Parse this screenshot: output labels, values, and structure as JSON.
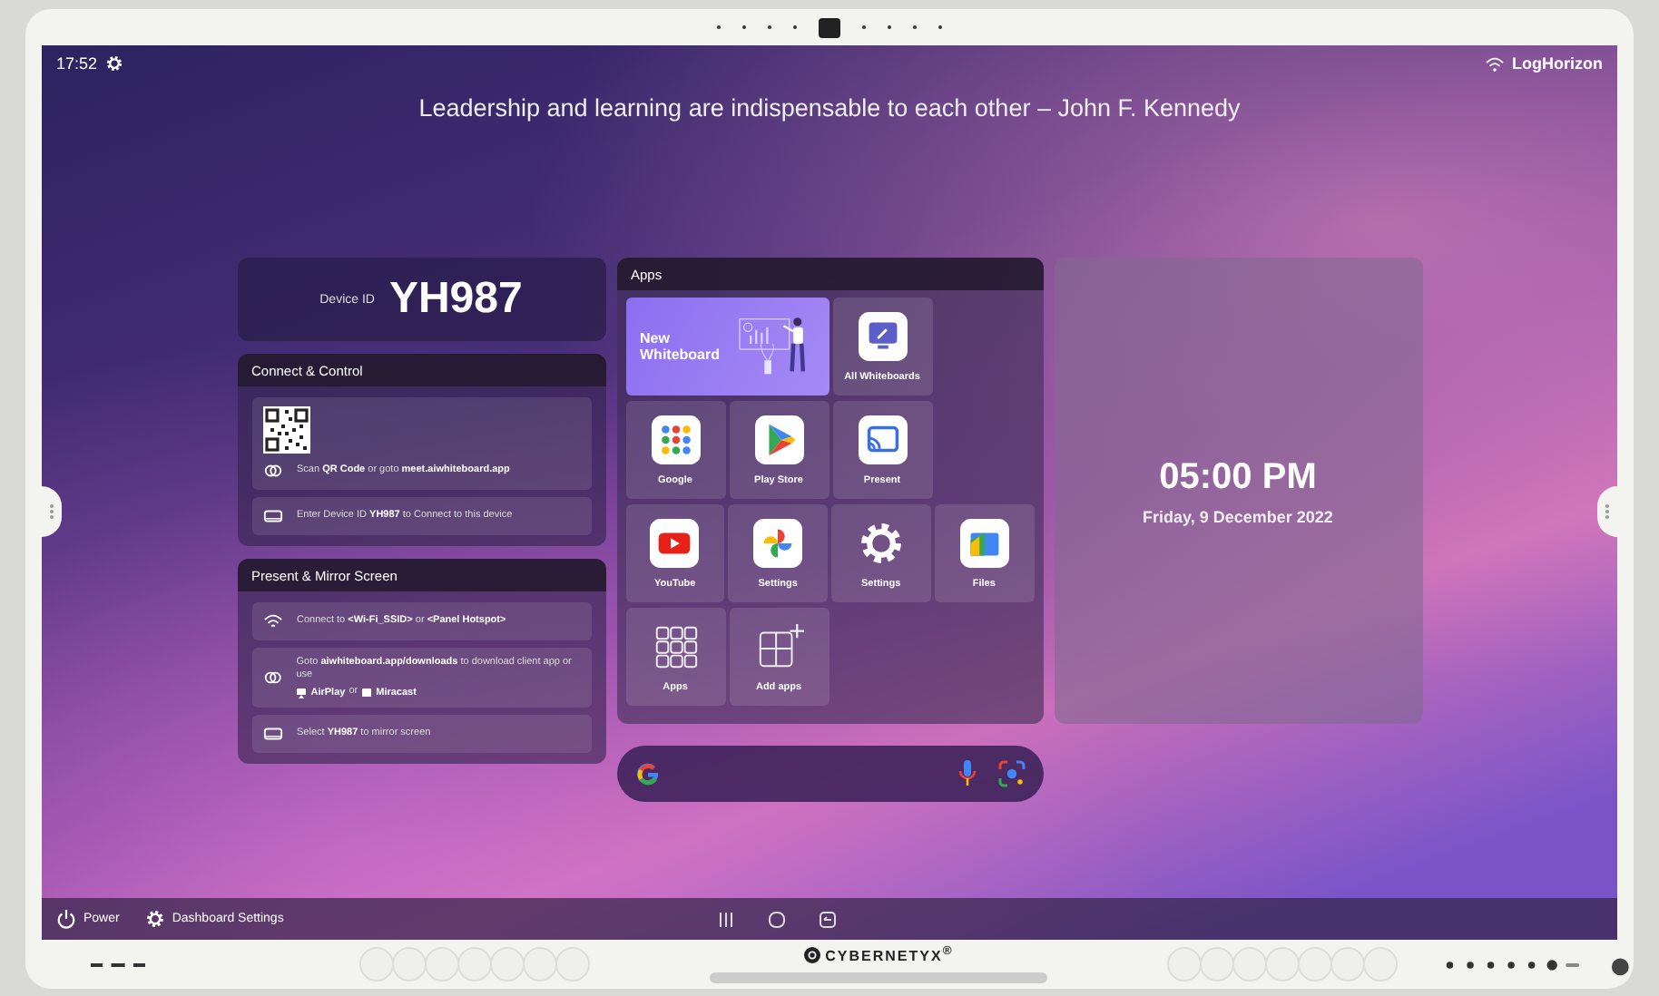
{
  "status_bar": {
    "time": "17:52",
    "network": "LogHorizon"
  },
  "quote": "Leadership and learning are indispensable to each other – John F. Kennedy",
  "device": {
    "label": "Device ID",
    "id": "YH987"
  },
  "connect": {
    "title": "Connect & Control",
    "rows": [
      {
        "kind": "qr",
        "text": "Scan **QR Code** or goto **meet.aiwhiteboard.app**"
      },
      {
        "kind": "device",
        "text": "Enter Device ID **YH987** to Connect to this device"
      }
    ]
  },
  "present": {
    "title": "Present & Mirror Screen",
    "rows": [
      {
        "kind": "wifi",
        "text": "Connect to **<Wi-Fi_SSID>** or **<Panel Hotspot>**"
      },
      {
        "kind": "link",
        "text": "Goto **aiwhiteboard.app/downloads** to download client app or use",
        "joiner": "or",
        "options": [
          {
            "kind": "airplay",
            "label": "AirPlay"
          },
          {
            "kind": "miracast",
            "label": "Miracast"
          }
        ]
      },
      {
        "kind": "device",
        "text": "Select **YH987** to mirror screen"
      }
    ]
  },
  "apps": {
    "title": "Apps",
    "rows": [
      [
        {
          "kind": "new",
          "label": "New Whiteboard"
        },
        "",
        {
          "kind": "whiteboards",
          "label": "All Whiteboards"
        }
      ],
      [
        {
          "kind": "google",
          "label": "Google"
        },
        {
          "kind": "play",
          "label": "Play Store"
        },
        {
          "kind": "cast",
          "label": "Present"
        }
      ],
      [
        {
          "kind": "youtube",
          "label": "YouTube"
        },
        {
          "kind": "photos",
          "label": "Settings"
        },
        {
          "kind": "gear",
          "label": "Settings"
        },
        {
          "kind": "files",
          "label": "Files"
        }
      ],
      [
        {
          "kind": "grid",
          "label": "Apps"
        },
        {
          "kind": "add",
          "label": "Add apps"
        }
      ]
    ]
  },
  "clock": {
    "time": "05:00 PM",
    "date": "Friday, 9 December 2022"
  },
  "bottom_bar": {
    "buttons": [
      {
        "kind": "power",
        "label": "Power"
      },
      {
        "kind": "settings",
        "label": "Dashboard Settings"
      }
    ]
  },
  "brand": "CYBERNETYX$^{®}$"
}
